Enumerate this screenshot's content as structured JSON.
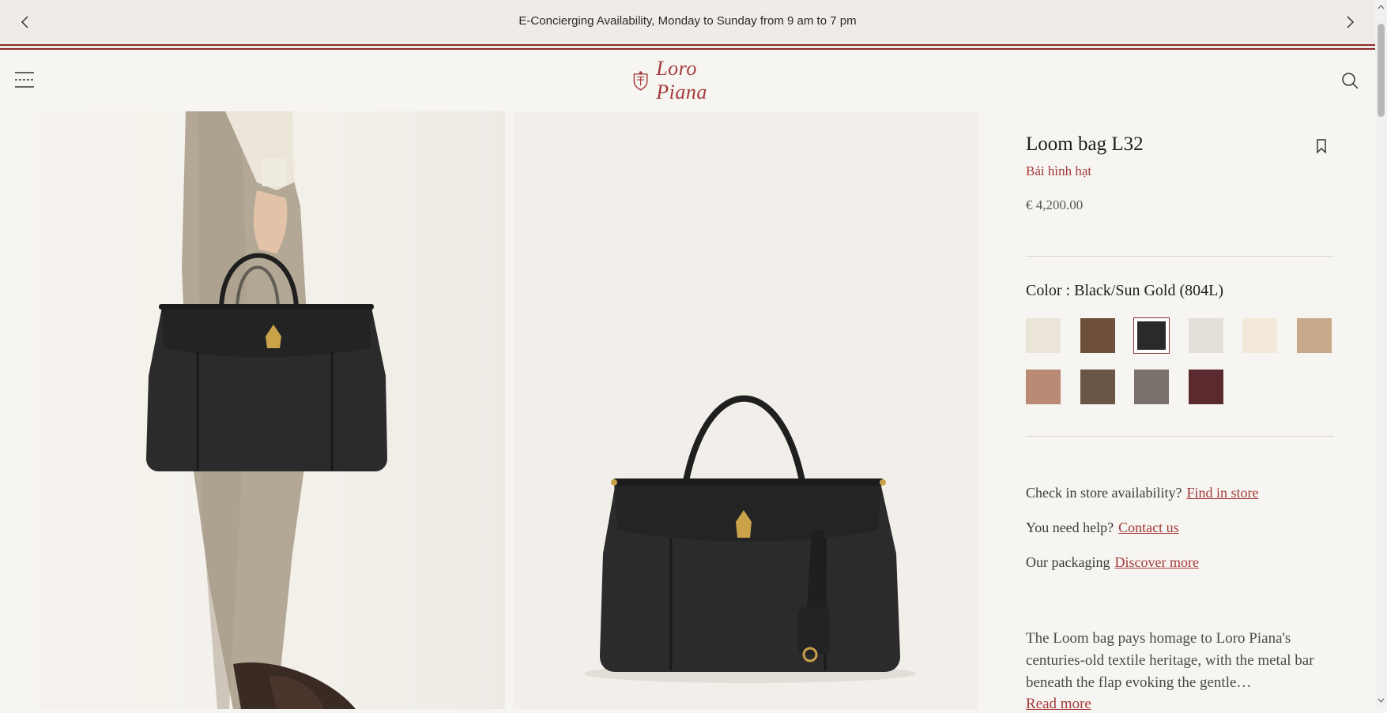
{
  "announcement": {
    "text": "E-Concierging Availability, Monday to Sunday from 9 am to 7 pm",
    "prev_icon": "chevron-left-icon",
    "next_icon": "chevron-right-icon"
  },
  "header": {
    "brand": "Loro Piana",
    "menu_icon": "hamburger-icon",
    "search_icon": "search-icon"
  },
  "product": {
    "title": "Loom bag L32",
    "subtitle": "Bải hình hạt",
    "price": "€ 4,200.00",
    "color_label": "Color : Black/Sun Gold (804L)",
    "swatches": [
      {
        "color": "#ebe4d8",
        "selected": false
      },
      {
        "color": "#6e4f39",
        "selected": false
      },
      {
        "color": "#2a2a2a",
        "selected": true
      },
      {
        "color": "#e4dfd8",
        "selected": false
      },
      {
        "color": "#f3e9d9",
        "selected": false
      },
      {
        "color": "#c9a88a",
        "selected": false
      },
      {
        "color": "#b98a74",
        "selected": false
      },
      {
        "color": "#6a5546",
        "selected": false
      },
      {
        "color": "#7a716c",
        "selected": false
      },
      {
        "color": "#5a2a2f",
        "selected": false
      }
    ],
    "store_text": "Check in store availability?",
    "store_link": "Find in store",
    "help_text": "You need help?",
    "help_link": "Contact us",
    "packaging_text": "Our packaging",
    "packaging_link": "Discover more",
    "description": "The Loom bag pays homage to Loro Piana's centuries-old textile heritage, with the metal bar beneath the flap evoking the gentle…",
    "read_more": "Read more"
  },
  "colors": {
    "accent": "#a23a3a",
    "bag": "#2b2b2b",
    "gold": "#c9a24a"
  }
}
